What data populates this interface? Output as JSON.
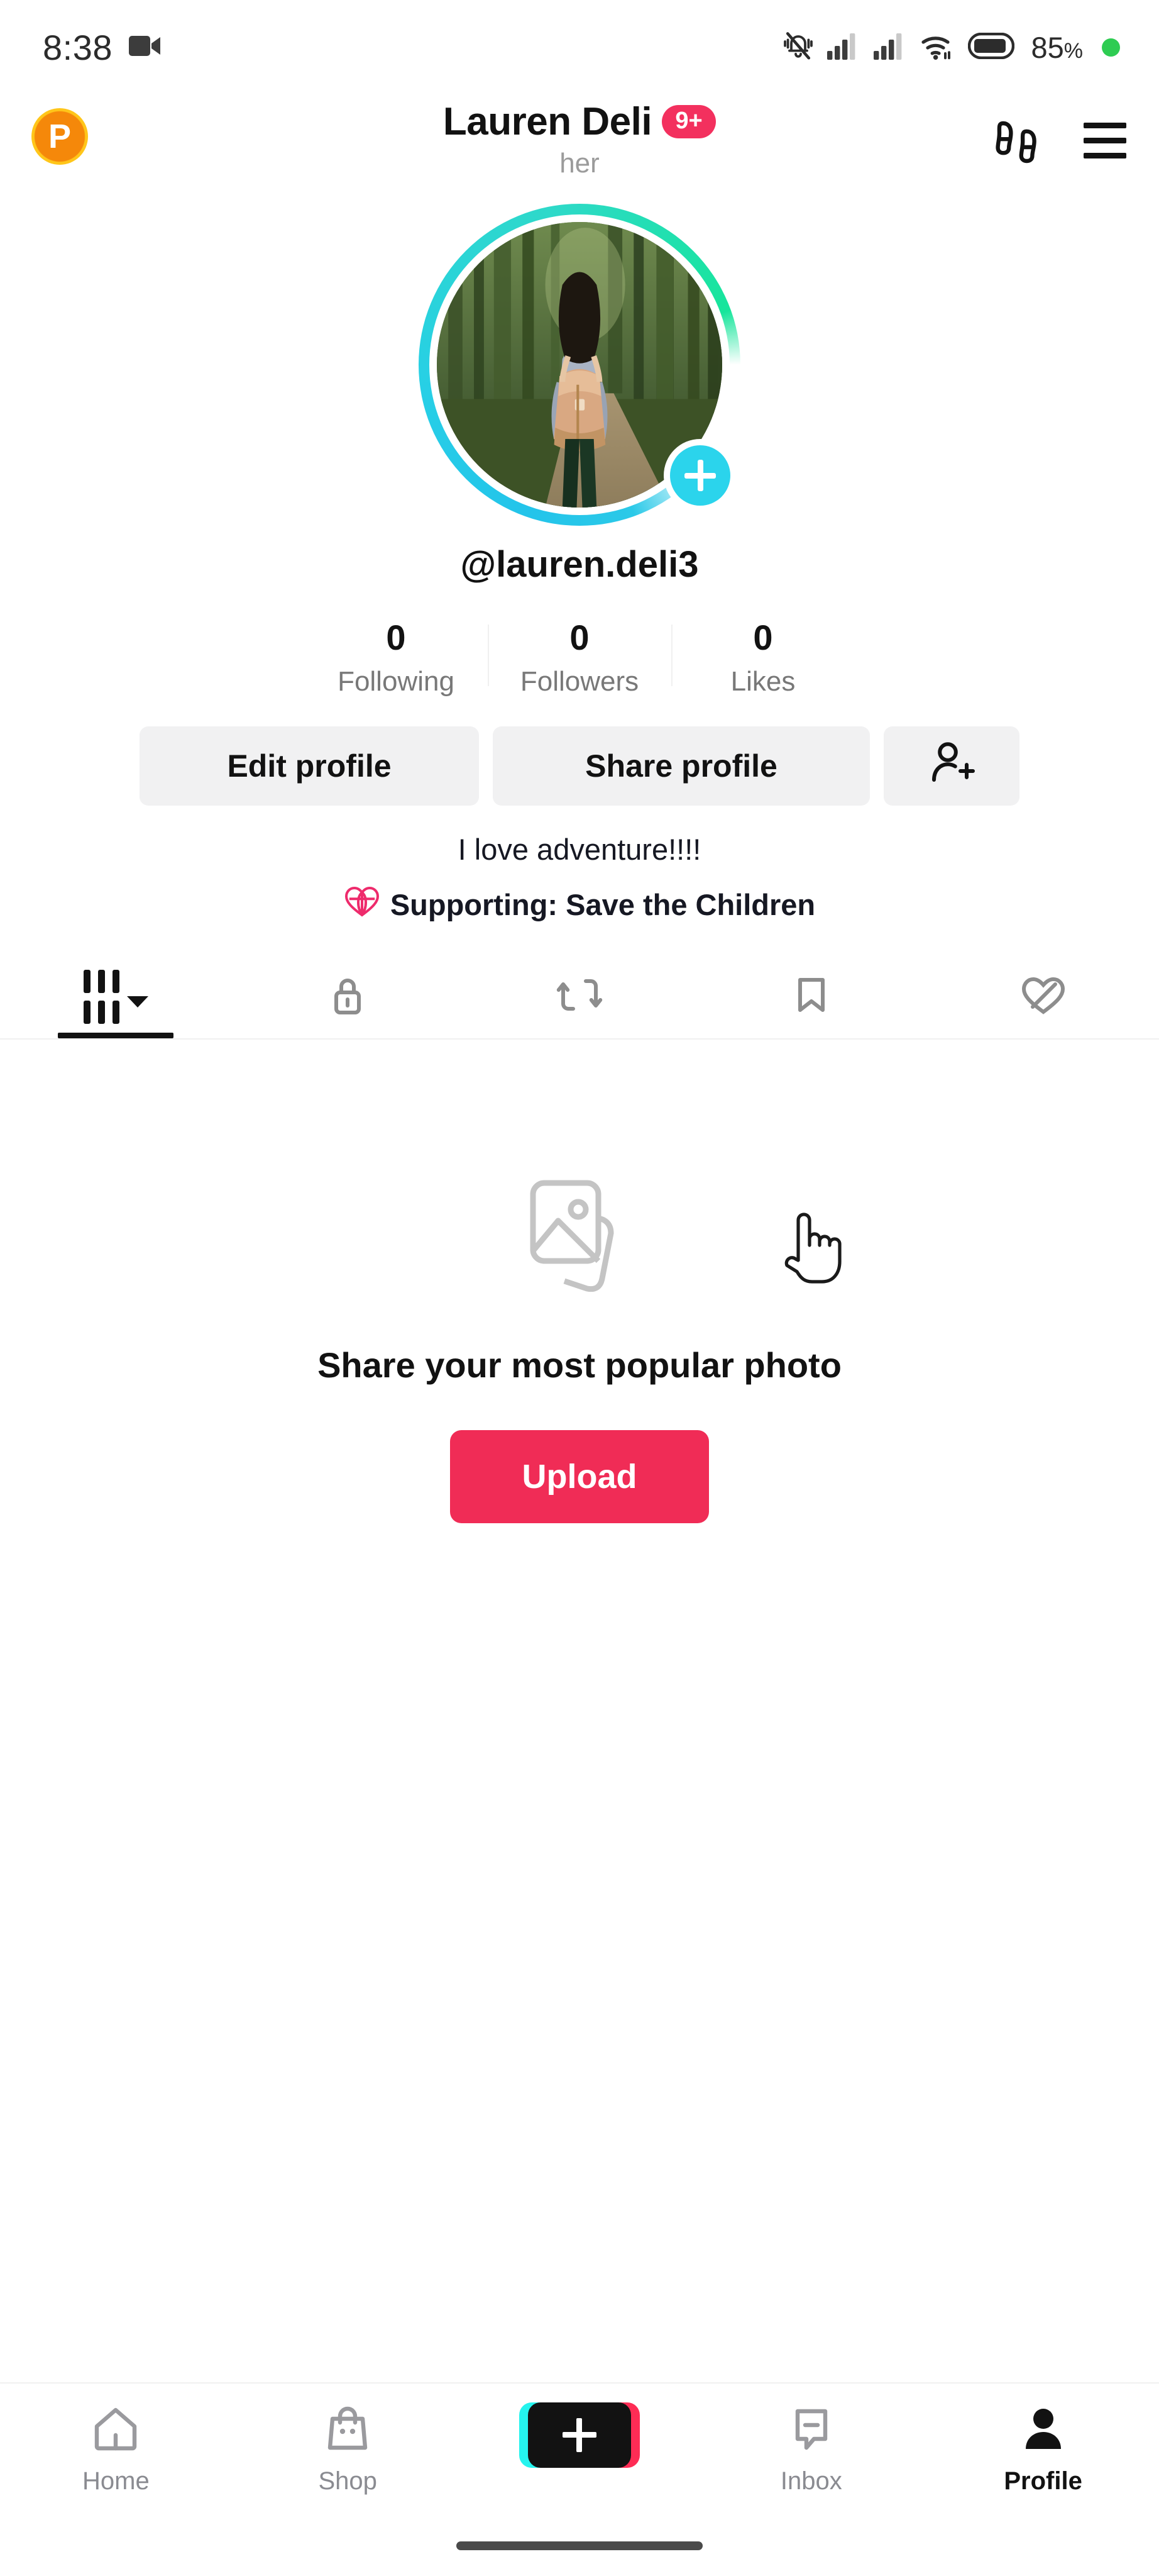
{
  "status_bar": {
    "time": "8:38",
    "left_icons": [
      "video-camera-icon"
    ],
    "right_icons": [
      "mute-bell-icon",
      "signal-1-icon",
      "signal-2-icon",
      "wifi-icon",
      "battery-icon"
    ],
    "battery_percent": "85",
    "percent_symbol": "%",
    "recording_dot": true
  },
  "header": {
    "coin_letter": "P",
    "title": "Lauren Deli",
    "badge": "9+",
    "pronoun": "her",
    "icons": [
      "footprints-icon",
      "hamburger-menu-icon"
    ]
  },
  "profile": {
    "avatar_alt": "woman hiking in forest with backpack",
    "add_story_icon": "plus-icon",
    "username": "@lauren.deli3",
    "stats": [
      {
        "value": "0",
        "label": "Following"
      },
      {
        "value": "0",
        "label": "Followers"
      },
      {
        "value": "0",
        "label": "Likes"
      }
    ],
    "actions": {
      "edit": "Edit profile",
      "share": "Share profile",
      "add_friends_icon": "add-person-icon"
    },
    "bio": "I love adventure!!!!",
    "supporting_icon": "heart-globe-icon",
    "supporting": "Supporting: Save the Children"
  },
  "tabs": [
    {
      "id": "posts",
      "icon": "grid-posts-icon",
      "active": true,
      "has_caret": true
    },
    {
      "id": "private",
      "icon": "lock-icon",
      "active": false
    },
    {
      "id": "reposts",
      "icon": "repost-arrows-icon",
      "active": false
    },
    {
      "id": "saved",
      "icon": "bookmark-icon",
      "active": false
    },
    {
      "id": "liked",
      "icon": "heart-liked-icon",
      "active": false
    }
  ],
  "empty_state": {
    "icon": "photo-stack-icon",
    "title": "Share your most popular photo",
    "button": "Upload"
  },
  "bottom_nav": [
    {
      "id": "home",
      "label": "Home",
      "icon": "house-icon",
      "active": false
    },
    {
      "id": "shop",
      "label": "Shop",
      "icon": "shopping-bag-icon",
      "active": false
    },
    {
      "id": "create",
      "label": "",
      "icon": "plus-create-icon",
      "active": false
    },
    {
      "id": "inbox",
      "label": "Inbox",
      "icon": "message-icon",
      "active": false
    },
    {
      "id": "profile",
      "label": "Profile",
      "icon": "person-icon",
      "active": true
    }
  ],
  "colors": {
    "accent_pink": "#F02C56",
    "badge_pink": "#F3305E",
    "tiktok_cyan": "#25F4EE",
    "tiktok_red": "#FE2C55",
    "story_cyan": "#2BD4EC",
    "coin_gold": "#FFC61A",
    "battery_green": "#2ecc52",
    "muted_gray": "#787878"
  }
}
